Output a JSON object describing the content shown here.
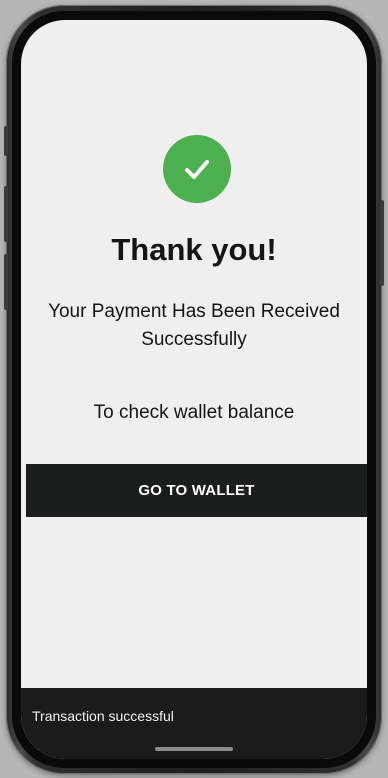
{
  "success": {
    "icon": "checkmark-icon",
    "title": "Thank you!",
    "message": "Your Payment Has Been Received Successfully",
    "hint": "To check wallet balance",
    "button_label": "GO TO WALLET"
  },
  "toast": {
    "text": "Transaction successful"
  },
  "colors": {
    "accent_green": "#4caf50",
    "button_bg": "#1c1d1d",
    "screen_bg": "#efefef",
    "toast_bg": "#1b1b1b"
  }
}
